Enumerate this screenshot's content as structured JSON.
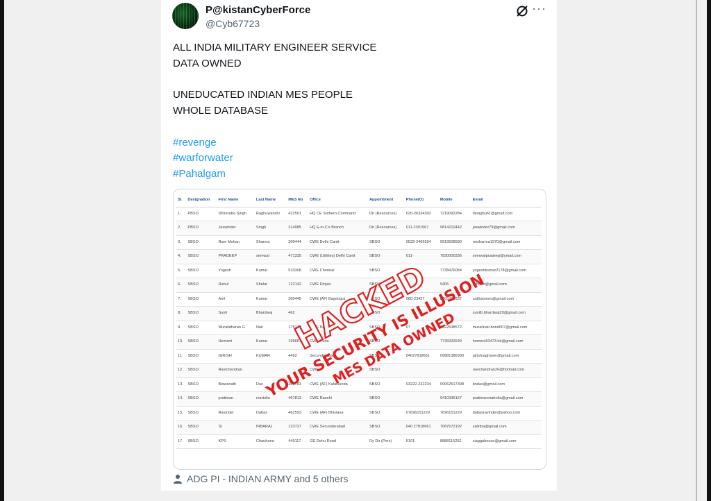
{
  "tweet": {
    "display_name": "P@kistanCyberForce",
    "handle": "@Cyb67723",
    "lines": [
      "ALL INDIA MILITARY ENGINEER SERVICE",
      "DATA OWNED",
      "UNEDUCATED INDIAN MES PEOPLE",
      "WHOLE DATABASE"
    ],
    "hashtags": [
      "#revenge",
      "#warforwater",
      "#Pahalgam"
    ],
    "footer": "ADG PI - INDIAN ARMY and 5 others"
  },
  "icons": {
    "grok": "grok-icon",
    "more": "more-icon",
    "people": "person-icon"
  },
  "colors": {
    "link": "#1d9bf0",
    "stamp_red": "#e02020",
    "header_blue": "#1f4e9c"
  },
  "table": {
    "headers": [
      "Sl.",
      "Designation",
      "First Name",
      "Last Name",
      "MES No",
      "Office",
      "Appointment",
      "Phone(O)",
      "Mobile",
      "Email"
    ],
    "rows": [
      [
        "1.",
        "PBSO",
        "Dhirendra Singh",
        "Raghuwanshi",
        "422501",
        "HQ CE Sothern Command",
        "Dir (Resources)",
        "020-26334302",
        "7219092284",
        "dsraghu61@gmail.com"
      ],
      [
        "2.",
        "PBSO",
        "Jaswinder",
        "Singh",
        "314985",
        "HQ E-in-C's Branch",
        "Dir (Resources)",
        "011-2301967",
        "9814210442",
        "jaswinder79@gmail.com"
      ],
      [
        "3.",
        "SBSO",
        "Ram Mohan",
        "Sharma",
        "300444",
        "CWE Delhi Cantt",
        "SBSO",
        "0532-2465504",
        "9919508580",
        "rmsharma1970@gmail.com"
      ],
      [
        "4.",
        "SBSO",
        "PRADEEP",
        "semwal",
        "471335",
        "CWE (Utilities) Delhi Cantt",
        "SBSO",
        "011-",
        "7830000336",
        "semwalpradeep@ymail.com"
      ],
      [
        "5.",
        "SBSO",
        "Yogesh",
        "Kumar",
        "510308",
        "CWE Chennai",
        "SBSO",
        "",
        "7738476084",
        "yogeshkumar2178@gmail.com"
      ],
      [
        "6.",
        "SBSO",
        "Rahul",
        "Shelar",
        "122142",
        "CWE Dinjan",
        "SBSO",
        "",
        "9405",
        "rahulss@gmail.com"
      ],
      [
        "7.",
        "SBSO",
        "Anil",
        "Kumar",
        "300445",
        "CWE (AF) Bagdogra",
        "SBSO",
        "080-23437",
        "8105999837",
        "anilbsomes@gmail.com"
      ],
      [
        "8.",
        "SBSO",
        "Sunil",
        "Bhardwaj",
        "462",
        "",
        "SBSO",
        "",
        "",
        "sunilb.bhardwaj29@gmail.com"
      ],
      [
        "9.",
        "SBSO",
        "Muralidharan G",
        "Nair",
        "175272",
        "CWE Nagpur",
        "SBSO",
        "07",
        "9822538572",
        "muralinair.bond007@gmail.com"
      ],
      [
        "10.",
        "SBSO",
        "Hemant",
        "Kumar",
        "195667",
        "CWE Pune",
        "SBSO",
        "",
        "7726932649",
        "hemant10473.hk@gmail.com"
      ],
      [
        "11.",
        "SBSO",
        "GIRISH",
        "KUMAR",
        "4492",
        "Secunderabad",
        "SBSO",
        "04027818661",
        "09881386990",
        "girishraghaver@gmail.com"
      ],
      [
        "12.",
        "SBSO",
        "Ravichandran",
        "",
        "",
        "CWE",
        "SBSO",
        "",
        "",
        "ravichandran26@hotmail.com"
      ],
      [
        "13.",
        "SBSO",
        "Biswanath",
        "Das",
        "203783",
        "CWE (AF) Kalaikunda",
        "SBSO",
        "03222-232234",
        "09062517398",
        "bndas@gmail.com"
      ],
      [
        "14.",
        "SBSO",
        "pratiman",
        "martolia",
        "467813",
        "CWE Ranchi",
        "SBSO",
        "",
        "9410336167",
        "pratimanmartolia@gmail.com"
      ],
      [
        "15.",
        "SBSO",
        "Ravinder",
        "Dabas",
        "462593",
        "CWE (AF) Bhisiana",
        "SBSO",
        "07696151229",
        "7696151229",
        "dabasravinder@yahoo.com"
      ],
      [
        "16.",
        "SBSO",
        "SI",
        "INBARAJ",
        "123727",
        "CWE Secunderabad",
        "SBSO",
        "040 27818661",
        "7087672192",
        "salinba@gmail.com"
      ],
      [
        "17.",
        "SBSO",
        "KPS",
        "Chauhana",
        "449117",
        "GE Dehu Road",
        "Dy Dir (Pers)",
        "5101",
        "8888116252",
        "siaggahouse@gmail.com"
      ]
    ]
  },
  "stamp": {
    "word": "HACKED",
    "line1": "YOUR SECURITY IS ILLUSION",
    "line2": "MES DATA OWNED"
  }
}
